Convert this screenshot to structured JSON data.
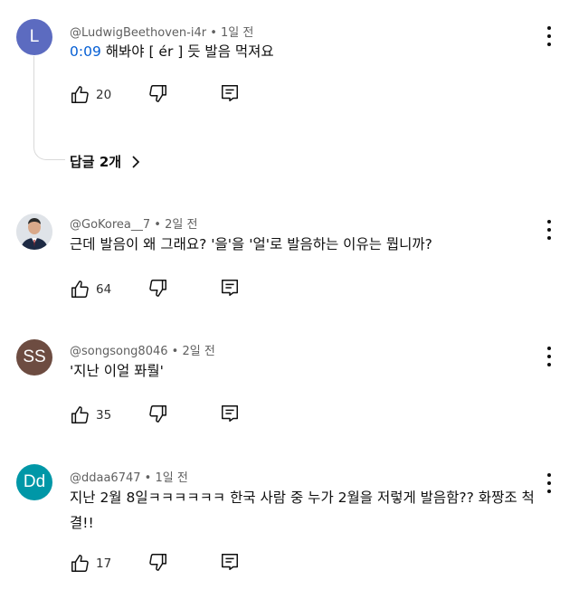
{
  "comments": [
    {
      "avatar_letter": "L",
      "avatar_color": "#5c6bc0",
      "author": "@LudwigBeethoven-i4r",
      "time": "1일 전",
      "timestamp": "0:09",
      "text": "해봐야 [ ér ] 듯  발음 먹져요",
      "likes": "20",
      "replies_label": "답글 2개"
    },
    {
      "avatar_letter": "",
      "avatar_color": "#e8e8e8",
      "author": "@GoKorea__7",
      "time": "2일 전",
      "text": "근데 발음이 왜 그래요?   '을'을 '얼'로 발음하는 이유는 뭡니까?",
      "likes": "64"
    },
    {
      "avatar_letter": "SS",
      "avatar_color": "#6d4c41",
      "author": "@songsong8046",
      "time": "2일 전",
      "text": "'지난 이얼 퐈뤌'",
      "likes": "35"
    },
    {
      "avatar_letter": "Dd",
      "avatar_color": "#0097a7",
      "author": "@ddaa6747",
      "time": "1일 전",
      "text": "지난 2월 8일ㅋㅋㅋㅋㅋㅋ 한국 사람 중 누가 2월을 저렇게 발음함?? 화짱조 척결!!",
      "likes": "17"
    }
  ],
  "separator": "•",
  "icons": {
    "like": "thumbs-up-icon",
    "dislike": "thumbs-down-icon",
    "reply": "reply-icon",
    "menu": "more-vert-icon",
    "expand": "chevron-right-icon"
  }
}
